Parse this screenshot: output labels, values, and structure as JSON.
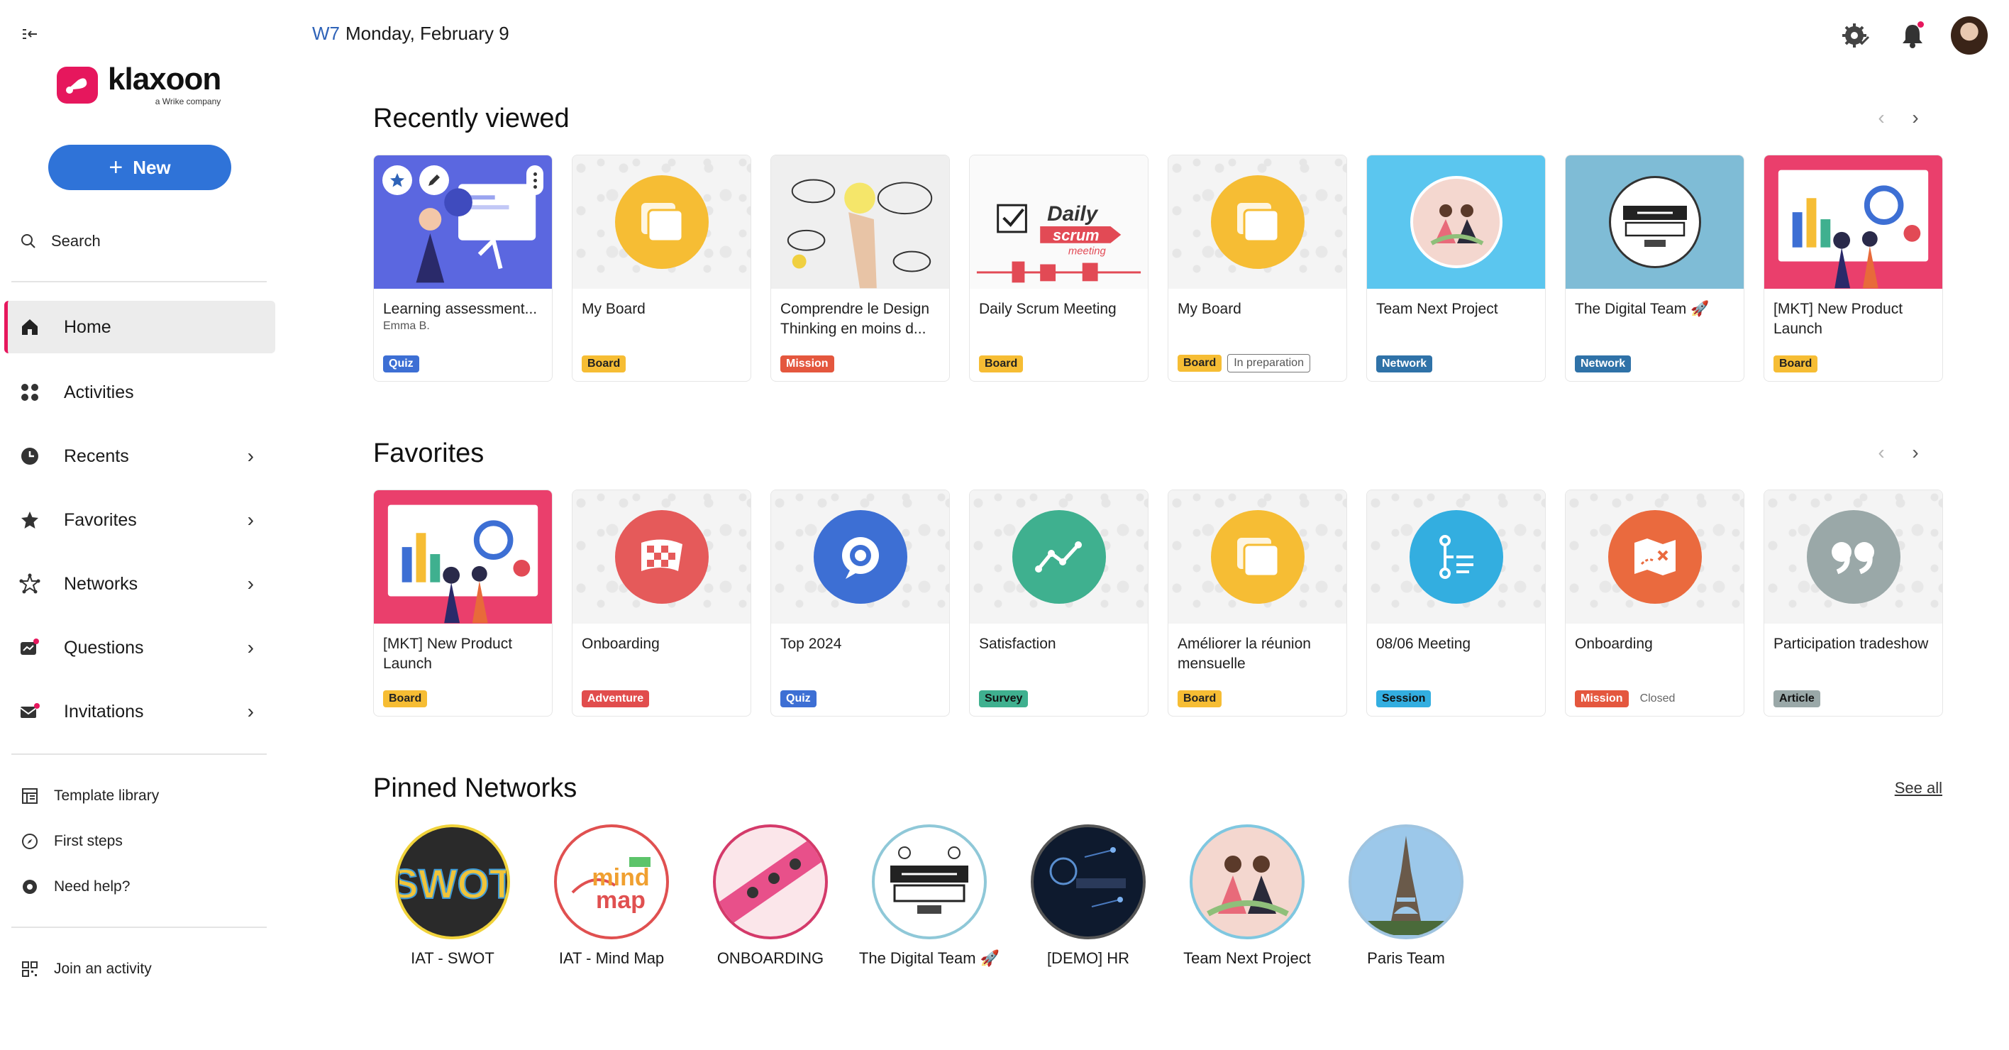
{
  "brand": {
    "name": "klaxoon",
    "sub": "a Wrike company"
  },
  "sidebar": {
    "new_label": "New",
    "search_label": "Search",
    "nav": [
      {
        "label": "Home",
        "icon": "home-icon",
        "active": true
      },
      {
        "label": "Activities",
        "icon": "activities-icon"
      },
      {
        "label": "Recents",
        "icon": "clock-icon"
      },
      {
        "label": "Favorites",
        "icon": "star-icon"
      },
      {
        "label": "Networks",
        "icon": "network-icon"
      },
      {
        "label": "Questions",
        "icon": "questions-icon"
      },
      {
        "label": "Invitations",
        "icon": "invitation-icon"
      }
    ],
    "links": [
      {
        "label": "Template library"
      },
      {
        "label": "First steps"
      },
      {
        "label": "Need help?"
      }
    ],
    "join_label": "Join an activity"
  },
  "header": {
    "week": "W7",
    "date": "Monday, February 9"
  },
  "recent": {
    "title": "Recently viewed",
    "cards": [
      {
        "title": "Learning assessment...",
        "sub": "Emma B.",
        "tags": [
          "Quiz"
        ]
      },
      {
        "title": "My Board",
        "tags": [
          "Board"
        ]
      },
      {
        "title": "Comprendre le Design Thinking en moins d...",
        "tags": [
          "Mission"
        ]
      },
      {
        "title": "Daily Scrum Meeting",
        "tags": [
          "Board"
        ]
      },
      {
        "title": "My Board",
        "tags": [
          "Board",
          "In preparation"
        ]
      },
      {
        "title": "Team Next Project",
        "tags": [
          "Network"
        ]
      },
      {
        "title": "The Digital Team 🚀",
        "tags": [
          "Network"
        ]
      },
      {
        "title": "[MKT] New Product Launch",
        "tags": [
          "Board"
        ]
      }
    ]
  },
  "favorites": {
    "title": "Favorites",
    "cards": [
      {
        "title": "[MKT] New Product Launch",
        "tags": [
          "Board"
        ]
      },
      {
        "title": "Onboarding",
        "tags": [
          "Adventure"
        ]
      },
      {
        "title": "Top 2024",
        "tags": [
          "Quiz"
        ]
      },
      {
        "title": "Satisfaction",
        "tags": [
          "Survey"
        ]
      },
      {
        "title": "Améliorer la réunion mensuelle",
        "tags": [
          "Board"
        ]
      },
      {
        "title": "08/06 Meeting",
        "tags": [
          "Session"
        ]
      },
      {
        "title": "Onboarding",
        "tags": [
          "Mission",
          "Closed"
        ]
      },
      {
        "title": "Participation tradeshow",
        "tags": [
          "Article"
        ]
      }
    ]
  },
  "pinned": {
    "title": "Pinned Networks",
    "see_all": "See all",
    "items": [
      {
        "label": "IAT - SWOT",
        "ring": "#f0d23a"
      },
      {
        "label": "IAT - Mind Map",
        "ring": "#e05050"
      },
      {
        "label": "ONBOARDING",
        "ring": "#d43a6a"
      },
      {
        "label": "The Digital Team 🚀",
        "ring": "#8fc8d8"
      },
      {
        "label": "[DEMO] HR",
        "ring": "#555555"
      },
      {
        "label": "Team Next Project",
        "ring": "#7fc7e0"
      },
      {
        "label": "Paris Team",
        "ring": "#9fc4e0"
      }
    ]
  },
  "colors": {
    "accent": "#e6175d",
    "primary": "#2f73d8"
  }
}
